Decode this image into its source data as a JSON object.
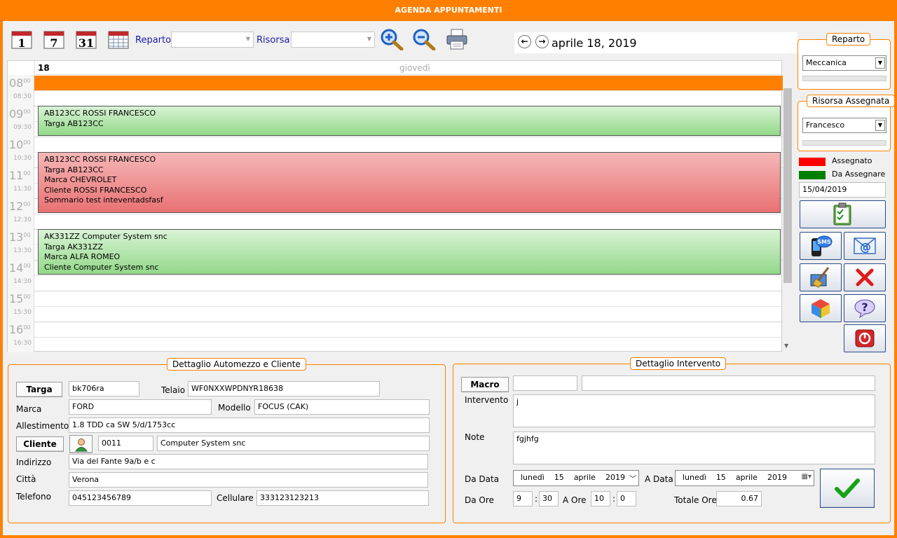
{
  "window": {
    "title": "AGENDA APPUNTAMENTI"
  },
  "toolbar": {
    "view_icons": [
      "calendar-day-icon",
      "calendar-week-icon",
      "calendar-month-icon",
      "calendar-grid-icon"
    ],
    "view_numbers": [
      "1",
      "7",
      "31"
    ],
    "reparto_label": "Reparto",
    "reparto_value": "",
    "risorsa_label": "Risorsa",
    "risorsa_value": "",
    "zoom_in_icon": "zoom-in-icon",
    "zoom_out_icon": "zoom-out-icon",
    "print_icon": "printer-icon"
  },
  "navigator": {
    "prev": "←",
    "next": "→",
    "date": "aprile 18, 2019"
  },
  "calendar": {
    "day_number": "18",
    "day_name": "giovedì",
    "hours": [
      "08",
      "09",
      "10",
      "11",
      "12",
      "13",
      "14",
      "15",
      "16"
    ],
    "hour_sup": "00",
    "half_hours": [
      "08:30",
      "09:30",
      "10:30",
      "11:30",
      "12:30",
      "13:30",
      "14:30",
      "15:30",
      "16:30"
    ],
    "events": [
      {
        "lines": []
      },
      {
        "lines": [
          "AB123CC ROSSI FRANCESCO",
          "Targa AB123CC"
        ]
      },
      {
        "lines": [
          "AB123CC ROSSI FRANCESCO",
          "Targa AB123CC",
          "Marca CHEVROLET",
          "Cliente ROSSI FRANCESCO",
          "Sommario test inteventadsfasf"
        ]
      },
      {
        "lines": [
          "AK331ZZ Computer System snc",
          "Targa AK331ZZ",
          "Marca ALFA ROMEO",
          "Cliente Computer System snc"
        ]
      }
    ]
  },
  "side": {
    "reparto_title": "Reparto",
    "reparto_value": "Meccanica",
    "risorsa_title": "Risorsa Assegnata",
    "risorsa_value": "Francesco",
    "legend": [
      {
        "label": "Assegnato",
        "color": "#ff0000"
      },
      {
        "label": "Da Assegnare",
        "color": "#008000"
      }
    ],
    "date": "15/04/2019",
    "buttons": [
      "clipboard-checklist-icon",
      "sms-phone-icon",
      "email-icon",
      "broom-clean-icon",
      "delete-x-icon",
      "cube-icon",
      "help-question-icon",
      "power-exit-icon"
    ]
  },
  "vehicle": {
    "title": "Dettaglio Automezzo e Cliente",
    "targa_btn": "Targa",
    "targa": "bk706ra",
    "telaio_label": "Telaio",
    "telaio": "WF0NXXWPDNYR18638",
    "marca_label": "Marca",
    "marca": "FORD",
    "modello_label": "Modello",
    "modello": "FOCUS (CAK)",
    "allestimento_label": "Allestimento",
    "allestimento": "1.8 TDD ca SW 5/d/1753cc",
    "cliente_btn": "Cliente",
    "cliente_code": "0011",
    "cliente_name": "Computer System snc",
    "indirizzo_label": "Indirizzo",
    "indirizzo": "Via del Fante 9a/b e c",
    "citta_label": "Città",
    "citta": "Verona",
    "telefono_label": "Telefono",
    "telefono": "045123456789",
    "cellulare_label": "Cellulare",
    "cellulare": "333123123213"
  },
  "intervento": {
    "title": "Dettaglio Intervento",
    "macro_btn": "Macro",
    "macro_code": "",
    "macro_desc": "",
    "intervento_label": "Intervento",
    "intervento": "j",
    "note_label": "Note",
    "note": "fgjhfg",
    "da_data_label": "Da Data",
    "da_data": {
      "dow": "lunedì",
      "day": "15",
      "month": "aprile",
      "year": "2019"
    },
    "a_data_label": "A Data",
    "a_data": {
      "dow": "lunedì",
      "day": "15",
      "month": "aprile",
      "year": "2019"
    },
    "da_ore_label": "Da Ore",
    "da_ore_h": "9",
    "da_ore_m": "30",
    "a_ore_label": "A Ore",
    "a_ore_h": "10",
    "a_ore_m": "0",
    "totale_label": "Totale Ore",
    "totale": "0.67",
    "colon": ":",
    "confirm_icon": "checkmark-icon"
  }
}
